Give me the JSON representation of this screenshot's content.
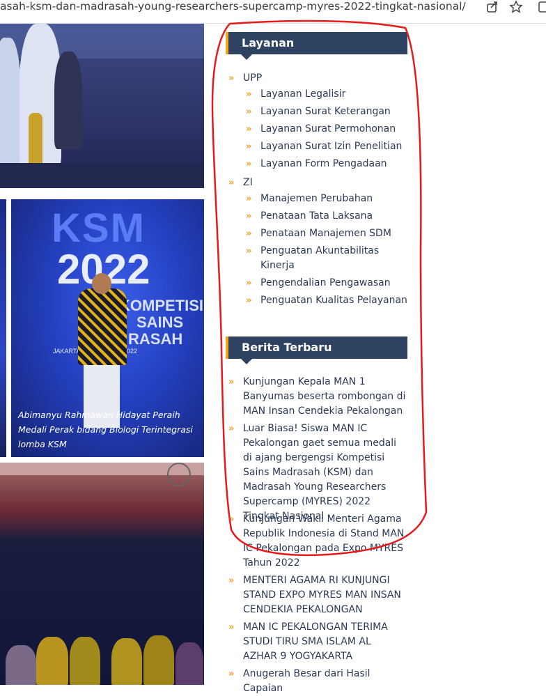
{
  "browser": {
    "url": "asah-ksm-dan-madrasah-young-researchers-supercamp-myres-2022-tingkat-nasional/",
    "share_icon": "share-icon",
    "bookmark_icon": "star-icon",
    "extension_icon": "extension-icon"
  },
  "photos": {
    "ksm": {
      "big_text": "KSM",
      "year_text": "2022",
      "line1": "KOMPETISI",
      "line2": "SAINS",
      "line3": "RASAH",
      "place": "JAKARTA, ... OKTOBER 2022",
      "caption": "Abimanyu Rahmawan Hidayat Peraih Medali Perak bidang Biologi Terintegrasi lomba KSM"
    }
  },
  "layanan": {
    "title": "Layanan",
    "groups": [
      {
        "label": "UPP",
        "children": [
          "Layanan Legalisir",
          "Layanan Surat Keterangan",
          "Layanan Surat Permohonan",
          "Layanan Surat Izin Penelitian",
          "Layanan Form Pengadaan"
        ]
      },
      {
        "label": "ZI",
        "children": [
          "Manajemen Perubahan",
          "Penataan Tata Laksana",
          "Penataan Manajemen SDM",
          "Penguatan Akuntabilitas Kinerja",
          "Pengendalian Pengawasan",
          "Penguatan Kualitas Pelayanan"
        ]
      }
    ]
  },
  "berita": {
    "title": "Berita Terbaru",
    "items": [
      "Kunjungan Kepala MAN 1 Banyumas beserta rombongan di MAN Insan Cendekia Pekalongan",
      "Luar Biasa! Siswa MAN IC Pekalongan gaet semua medali di ajang bergengsi Kompetisi Sains Madrasah (KSM) dan Madrasah Young Researchers Supercamp (MYRES) 2022 Tingkat Nasional",
      "Kunjungan Wakil Menteri Agama Republik Indonesia di Stand MAN IC Pekalongan pada Expo MYRES Tahun 2022",
      "MENTERI AGAMA RI KUNJUNGI STAND EXPO MYRES MAN INSAN CENDEKIA PEKALONGAN",
      "MAN IC PEKALONGAN TERIMA STUDI TIRU SMA ISLAM AL AZHAR 9 YOGYAKARTA",
      "Anugerah Besar dari Hasil Capaian"
    ]
  },
  "colors": {
    "widget_head": "#2d4361",
    "accent": "#f3a51d",
    "annotation": "#e31b1b"
  }
}
